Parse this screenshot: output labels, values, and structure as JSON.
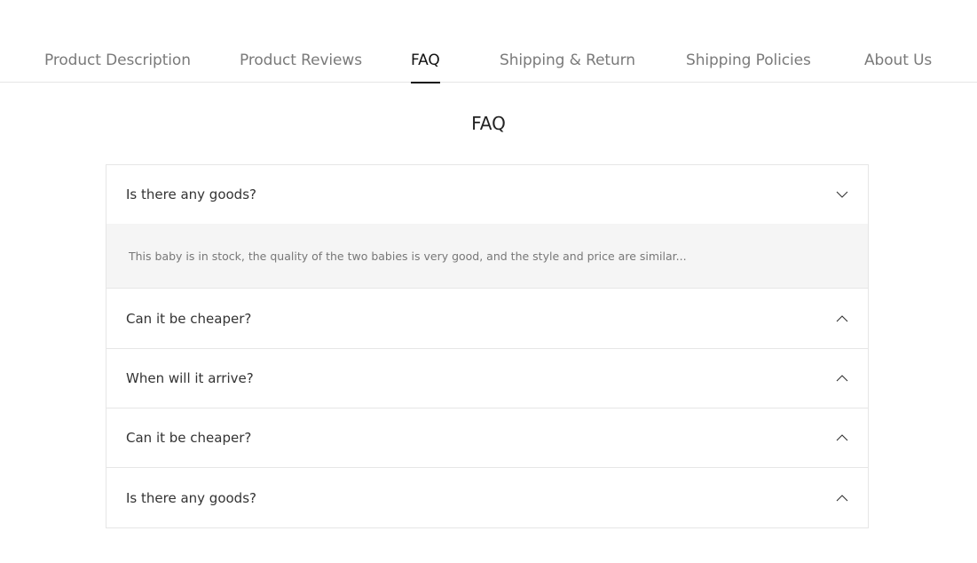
{
  "tabs": [
    {
      "label": "Product Description"
    },
    {
      "label": "Product Reviews"
    },
    {
      "label": "FAQ",
      "active": true
    },
    {
      "label": "Shipping & Return"
    },
    {
      "label": "Shipping Policies"
    },
    {
      "label": "About Us"
    }
  ],
  "faq": {
    "title": "FAQ",
    "items": [
      {
        "question": "Is there any goods?",
        "answer": "This baby is in stock, the quality of the two babies is very good, and the style and price are similar...",
        "expanded": true,
        "icon": "chevron-down-icon"
      },
      {
        "question": "Can it be cheaper?",
        "expanded": false,
        "icon": "chevron-up-icon"
      },
      {
        "question": "When will it arrive?",
        "expanded": false,
        "icon": "chevron-up-icon"
      },
      {
        "question": "Can it be cheaper?",
        "expanded": false,
        "icon": "chevron-up-icon"
      },
      {
        "question": "Is there any goods?",
        "expanded": false,
        "icon": "chevron-up-icon"
      }
    ]
  },
  "colors": {
    "text_primary": "#111111",
    "text_muted": "#7a7a7a",
    "border": "#e6e6e6",
    "answer_bg": "#f5f5f5"
  }
}
